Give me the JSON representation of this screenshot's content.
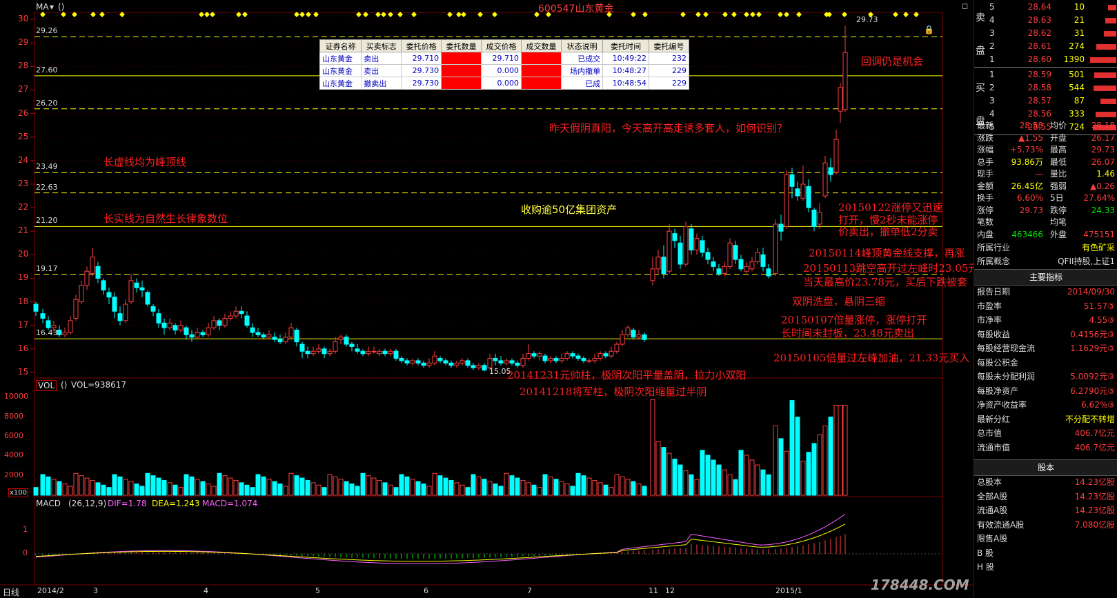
{
  "header": {
    "ma_label": "MA",
    "ma_params": "()",
    "stock_title": "600547山东黄金"
  },
  "price_axis": [
    "30",
    "29",
    "28",
    "27",
    "26",
    "25",
    "24",
    "23",
    "22",
    "21",
    "20",
    "19",
    "18",
    "17",
    "16",
    "15"
  ],
  "price_levels": [
    {
      "label": "29.26",
      "value": 29.26,
      "style": "dash"
    },
    {
      "label": "27.60",
      "value": 27.6,
      "style": "solid"
    },
    {
      "label": "26.20",
      "value": 26.2,
      "style": "dash"
    },
    {
      "label": "23.49",
      "value": 23.49,
      "style": "dash"
    },
    {
      "label": "22.63",
      "value": 22.63,
      "style": "dash"
    },
    {
      "label": "21.20",
      "value": 21.2,
      "style": "solid"
    },
    {
      "label": "19.17",
      "value": 19.17,
      "style": "dash"
    },
    {
      "label": "16.43",
      "value": 16.43,
      "style": "solid"
    }
  ],
  "high_marker": "29.73",
  "low_marker": "15.05",
  "order_table": {
    "headers": [
      "证券名称",
      "买卖标志",
      "委托价格",
      "委托数量",
      "成交价格",
      "成交数量",
      "状态说明",
      "委托时间",
      "委托编号"
    ],
    "rows": [
      [
        "山东黄金",
        "卖出",
        "29.710",
        "",
        "29.710",
        "",
        "已成交",
        "10:49:22",
        "232"
      ],
      [
        "山东黄金",
        "卖出",
        "29.730",
        "",
        "0.000",
        "",
        "场内撤单",
        "10:48:27",
        "229"
      ],
      [
        "山东黄金",
        "撤卖出",
        "29.730",
        "",
        "0.000",
        "",
        "已成",
        "10:48:54",
        "229"
      ]
    ]
  },
  "annotations": {
    "n1": "回调仍是机会",
    "n2": "昨天假阴真阳，今天高开高走诱多套人，如何识别？",
    "n3": "长虚线均为峰顶线",
    "n4": "长实线为自然生长律象数位",
    "n5": "收购逾50亿集团资产",
    "n6": "20150122涨停又迅速",
    "n7": "打开，慢2秒未能涨停",
    "n8": "价卖出，撤单低2分卖",
    "n9": "20150114峰顶黄金线支撑，再涨",
    "n10": "20150113跳空高开过左峰时23.05元买入",
    "n11": "当天最高价23.78元，买后下跌被套",
    "n12": "双阴洗盘，悬阴三缩",
    "n13": "20150107倍量涨停，涨停打开",
    "n14": "长时间未封板，23.48元卖出",
    "n15": "20150105倍量过左峰加油，21.33元买入",
    "n16": "20141231元帅柱，极阴次阳平量盖阴，拉力小双阳",
    "n17": "20141218将军柱，极阴次阳缩量过半阴"
  },
  "volume_header": {
    "label": "VOL",
    "params": "()",
    "value": "VOL=938617"
  },
  "volume_axis": [
    "10000",
    "8000",
    "6000",
    "4000",
    "2000"
  ],
  "volume_unit": "x100",
  "macd_header": {
    "label": "MACD",
    "params": "(26,12,9)",
    "dif": "DIF=1.78",
    "dea": "DEA=1.243",
    "macd": "MACD=1.074"
  },
  "macd_axis": [
    "1",
    "0"
  ],
  "date_axis": {
    "period": "日线",
    "labels": [
      "2014/2",
      "3",
      "4",
      "5",
      "6",
      "7",
      "11",
      "12",
      "2015/1"
    ]
  },
  "order_book": {
    "sell_label": "卖盘",
    "buy_label": "买盘",
    "sell": [
      {
        "lvl": "5",
        "price": "28.64",
        "vol": "10"
      },
      {
        "lvl": "4",
        "price": "28.63",
        "vol": "21"
      },
      {
        "lvl": "3",
        "price": "28.62",
        "vol": "31"
      },
      {
        "lvl": "2",
        "price": "28.61",
        "vol": "274"
      },
      {
        "lvl": "1",
        "price": "28.60",
        "vol": "1390"
      }
    ],
    "buy": [
      {
        "lvl": "1",
        "price": "28.59",
        "vol": "501"
      },
      {
        "lvl": "2",
        "price": "28.58",
        "vol": "544"
      },
      {
        "lvl": "3",
        "price": "28.57",
        "vol": "87"
      },
      {
        "lvl": "4",
        "price": "28.56",
        "vol": "333"
      },
      {
        "lvl": "5",
        "price": "28.55",
        "vol": "724"
      }
    ]
  },
  "quote": [
    {
      "k1": "最新",
      "v1": "28.58",
      "k2": "均价",
      "v2": "28.18"
    },
    {
      "k1": "涨跌",
      "v1": "▲1.55",
      "k2": "开盘",
      "v2": "26.17"
    },
    {
      "k1": "涨幅",
      "v1": "+5.73%",
      "k2": "最高",
      "v2": "29.73"
    },
    {
      "k1": "总手",
      "v1": "93.86万",
      "k2": "最低",
      "v2": "26.07"
    },
    {
      "k1": "现手",
      "v1": "—",
      "k2": "量比",
      "v2": "1.46"
    },
    {
      "k1": "金额",
      "v1": "26.45亿",
      "k2": "强弱",
      "v2": "▲0.26"
    },
    {
      "k1": "换手",
      "v1": "6.60%",
      "k2": "5日",
      "v2": "27.64%"
    },
    {
      "k1": "涨停",
      "v1": "29.73",
      "k2": "跌停",
      "v2": "24.33"
    },
    {
      "k1": "笔数",
      "v1": "",
      "k2": "均笔",
      "v2": ""
    },
    {
      "k1": "内盘",
      "v1": "463466",
      "k2": "外盘",
      "v2": "475151"
    }
  ],
  "industry": {
    "k": "所属行业",
    "v": "有色矿采"
  },
  "concept": {
    "k": "所属概念",
    "v": "QFII持股,上证1"
  },
  "fundamentals_title": "主要指标",
  "fundamentals": [
    {
      "k": "报告日期",
      "v": "2014/09/30"
    },
    {
      "k": "市盈率",
      "v": "51.57③"
    },
    {
      "k": "市净率",
      "v": "4.55③"
    },
    {
      "k": "每股收益",
      "v": "0.4156元③"
    },
    {
      "k": "每股经营现金流",
      "v": "1.1629元③"
    },
    {
      "k": "每股公积金",
      "v": ""
    },
    {
      "k": "每股未分配利润",
      "v": "5.0092元③"
    },
    {
      "k": "每股净资产",
      "v": "6.2790元③"
    },
    {
      "k": "净资产收益率",
      "v": "6.62%③"
    },
    {
      "k": "最新分红",
      "v": "不分配不转增"
    },
    {
      "k": "总市值",
      "v": "406.7亿元"
    },
    {
      "k": "流通市值",
      "v": "406.7亿元"
    }
  ],
  "shares_title": "股本",
  "shares": [
    {
      "k": "总股本",
      "v": "14.23亿股"
    },
    {
      "k": "全部A股",
      "v": "14.23亿股"
    },
    {
      "k": "流通A股",
      "v": "14.23亿股"
    },
    {
      "k": "有效流通A股",
      "v": "7.080亿股"
    },
    {
      "k": "限售A股",
      "v": ""
    },
    {
      "k": "B 股",
      "v": ""
    },
    {
      "k": "H 股",
      "v": ""
    }
  ],
  "watermark": "178448.COM",
  "colors": {
    "up": "#ff4040",
    "down": "#00ffff",
    "level": "#ffff00",
    "border": "#7a0000"
  }
}
